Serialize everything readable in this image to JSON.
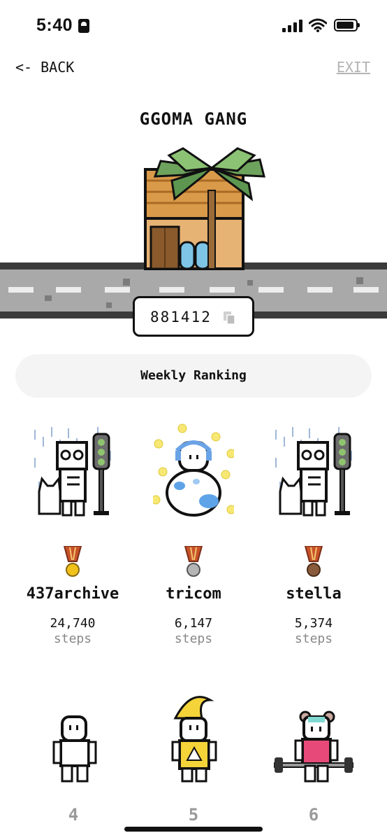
{
  "status_bar": {
    "time": "5:40"
  },
  "nav": {
    "back_label": "<- BACK",
    "exit_label": "EXIT"
  },
  "group": {
    "name": "GGOMA GANG",
    "code": "881412"
  },
  "ranking": {
    "tab_label": "Weekly Ranking",
    "top": [
      {
        "name": "437archive",
        "steps": "24,740",
        "unit": "steps",
        "medal": "gold"
      },
      {
        "name": "tricom",
        "steps": "6,147",
        "unit": "steps",
        "medal": "silver"
      },
      {
        "name": "stella",
        "steps": "5,374",
        "unit": "steps",
        "medal": "bronze"
      }
    ],
    "others": [
      {
        "rank": "4"
      },
      {
        "rank": "5"
      },
      {
        "rank": "6"
      }
    ]
  },
  "colors": {
    "gold": "#f2c21b",
    "silver": "#b5b5b5",
    "bronze": "#8a5a3c",
    "road": "#a9a9a9"
  }
}
